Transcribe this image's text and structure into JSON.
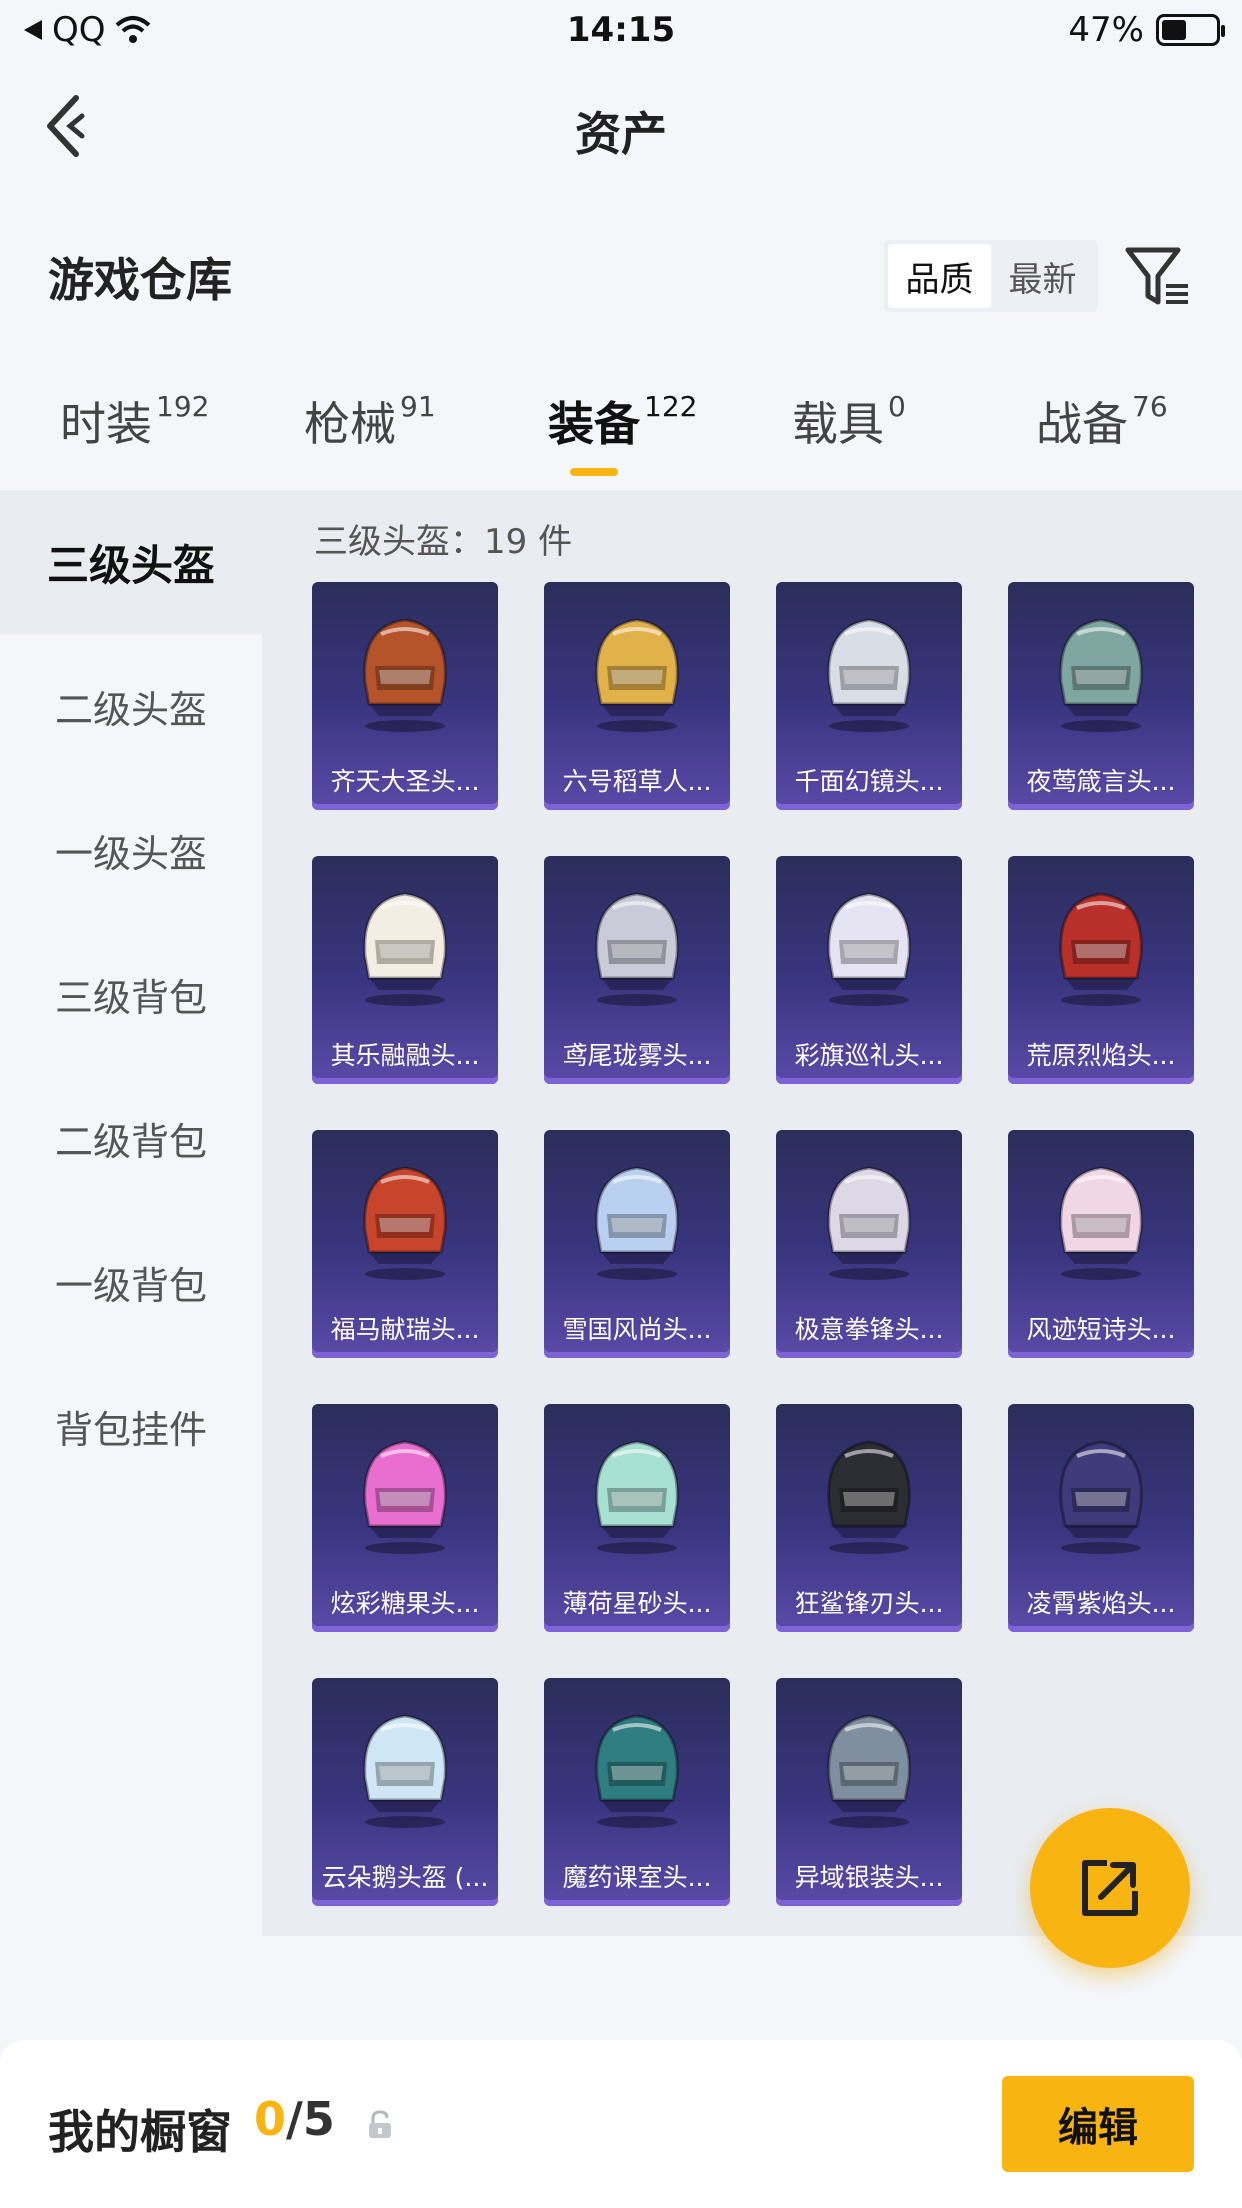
{
  "status_bar": {
    "carrier": "QQ",
    "time": "14:15",
    "battery_percent": "47%",
    "battery_level": 0.47
  },
  "nav": {
    "title": "资产"
  },
  "warehouse": {
    "title": "游戏仓库",
    "sort_options": [
      "品质",
      "最新"
    ],
    "sort_selected": "品质"
  },
  "tabs": [
    {
      "label": "时装",
      "count": "192"
    },
    {
      "label": "枪械",
      "count": "91"
    },
    {
      "label": "装备",
      "count": "122",
      "active": true
    },
    {
      "label": "载具",
      "count": "0"
    },
    {
      "label": "战备",
      "count": "76"
    }
  ],
  "sidebar": {
    "items": [
      "三级头盔",
      "二级头盔",
      "一级头盔",
      "三级背包",
      "二级背包",
      "一级背包",
      "背包挂件"
    ],
    "active_index": 0
  },
  "grid": {
    "count_label": "三级头盔：19 件",
    "items": [
      {
        "label": "齐天大圣头...",
        "color": "#b5542a"
      },
      {
        "label": "六号稻草人...",
        "color": "#e2b24a"
      },
      {
        "label": "千面幻镜头...",
        "color": "#d9dde6"
      },
      {
        "label": "夜莺箴言头...",
        "color": "#7fa6a0"
      },
      {
        "label": "其乐融融头...",
        "color": "#f3ede2"
      },
      {
        "label": "鸢尾珑雾头...",
        "color": "#c9ccd8"
      },
      {
        "label": "彩旗巡礼头...",
        "color": "#e6e4f2"
      },
      {
        "label": "荒原烈焰头...",
        "color": "#b9302a"
      },
      {
        "label": "福马献瑞头...",
        "color": "#c8442a"
      },
      {
        "label": "雪国风尚头...",
        "color": "#b9d0f0"
      },
      {
        "label": "极意拳锋头...",
        "color": "#dcd8e6"
      },
      {
        "label": "风迹短诗头...",
        "color": "#f1d6e6"
      },
      {
        "label": "炫彩糖果头...",
        "color": "#e86fcf"
      },
      {
        "label": "薄荷星砂头...",
        "color": "#a9e0d4"
      },
      {
        "label": "狂鲨锋刃头...",
        "color": "#2c2c33"
      },
      {
        "label": "凌霄紫焰头...",
        "color": "#3f3a7a"
      },
      {
        "label": "云朵鹅头盔 (...",
        "color": "#cfe6f5"
      },
      {
        "label": "魔药课室头...",
        "color": "#2f7d80"
      },
      {
        "label": "异域银装头...",
        "color": "#7f8fa0"
      }
    ]
  },
  "bottom_bar": {
    "showcase_label": "我的橱窗",
    "showcase_current": "0",
    "showcase_total": "/5",
    "edit_label": "编辑"
  }
}
